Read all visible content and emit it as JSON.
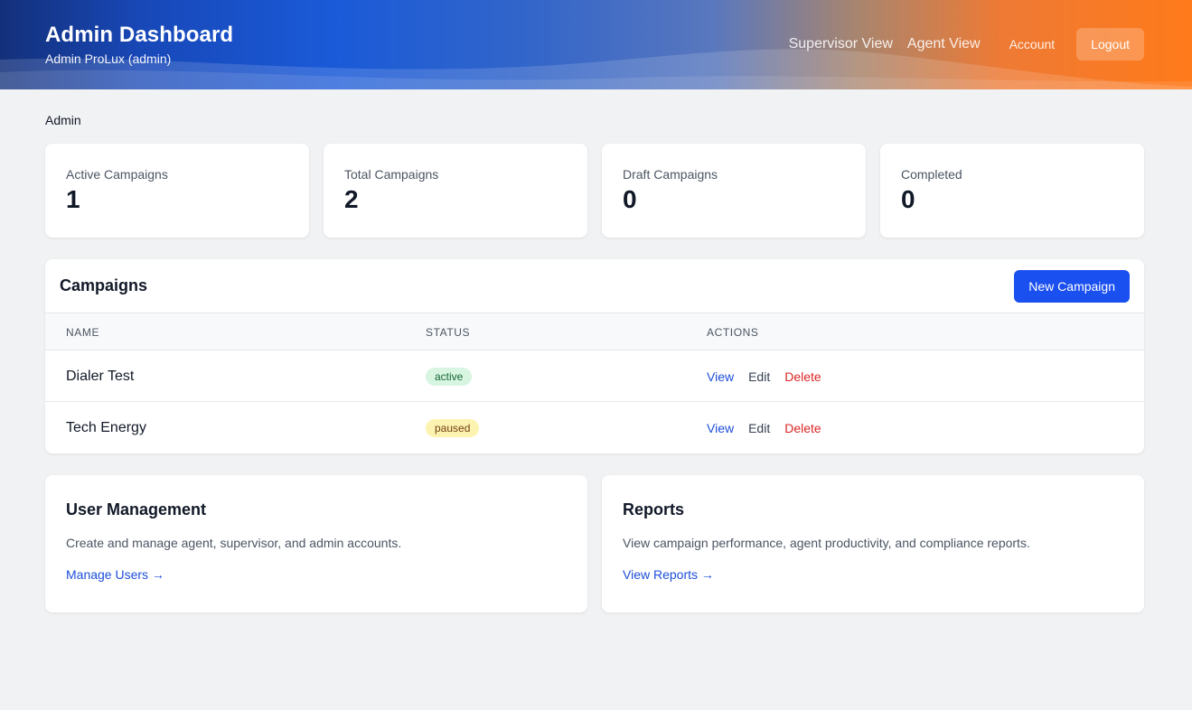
{
  "header": {
    "title": "Admin Dashboard",
    "subtitle": "Admin ProLux (admin)",
    "nav": {
      "supervisor_view": "Supervisor View",
      "agent_view": "Agent View",
      "account": "Account",
      "logout": "Logout"
    }
  },
  "breadcrumb": "Admin",
  "stats": [
    {
      "label": "Active Campaigns",
      "value": "1"
    },
    {
      "label": "Total Campaigns",
      "value": "2"
    },
    {
      "label": "Draft Campaigns",
      "value": "0"
    },
    {
      "label": "Completed",
      "value": "0"
    }
  ],
  "campaigns": {
    "title": "Campaigns",
    "new_button": "New Campaign",
    "columns": [
      "NAME",
      "STATUS",
      "ACTIONS"
    ],
    "rows": [
      {
        "name": "Dialer Test",
        "status": "active",
        "actions": [
          "View",
          "Edit",
          "Delete"
        ]
      },
      {
        "name": "Tech Energy",
        "status": "paused",
        "actions": [
          "View",
          "Edit",
          "Delete"
        ]
      }
    ]
  },
  "cards": [
    {
      "title": "User Management",
      "description": "Create and manage agent, supervisor, and admin accounts.",
      "link": "Manage Users →"
    },
    {
      "title": "Reports",
      "description": "View campaign performance, agent productivity, and compliance reports.",
      "link": "View Reports →"
    }
  ],
  "colors": {
    "primary": "#1a4ff0",
    "link": "#1d4ed8",
    "danger": "#dc2626",
    "badge_active_bg": "#d8f5e1",
    "badge_paused_bg": "#fdf3b0",
    "background": "#f1f2f4"
  }
}
